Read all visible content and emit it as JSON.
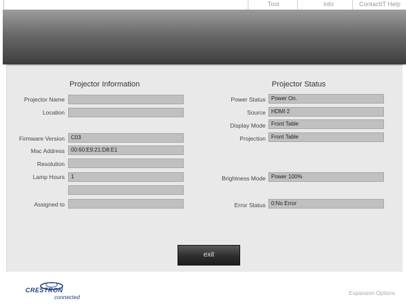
{
  "nav": {
    "tool": "Tool",
    "info": "Info",
    "contact": "ContactIT Help"
  },
  "left_section": {
    "title": "Projector Information",
    "fields": [
      {
        "label": "Projector Name",
        "value": ""
      },
      {
        "label": "Location",
        "value": ""
      },
      {
        "label": "Firmware Version",
        "value": "C03"
      },
      {
        "label": "Mac Address",
        "value": "00:60:E9:21:D8:E1"
      },
      {
        "label": "Resolution",
        "value": ""
      },
      {
        "label": "Lamp Hours",
        "value": "1"
      },
      {
        "label": "",
        "value": ""
      },
      {
        "label": "Assigned to",
        "value": ""
      }
    ]
  },
  "right_section": {
    "title": "Projector Status",
    "fields": [
      {
        "label": "Power Status",
        "value": "Power On."
      },
      {
        "label": "Source",
        "value": "HDMI 2"
      },
      {
        "label": "Display Mode",
        "value": "Front Table"
      },
      {
        "label": "Projection",
        "value": "Front Table"
      },
      {
        "label": "Brightness Mode",
        "value": "Power 100%"
      },
      {
        "label": "Error Status",
        "value": "0:No Error"
      }
    ]
  },
  "exit_label": "exit",
  "footer": {
    "logo_brand": "CRESTRON",
    "logo_sub": "connected",
    "expansion": "Expansion Options"
  },
  "colors": {
    "banner_top": "#9c9c9c",
    "banner_bottom": "#3d3d3d",
    "panel": "#e9e9e9",
    "field": "#c0c0c0",
    "logo": "#1d3d7a"
  }
}
